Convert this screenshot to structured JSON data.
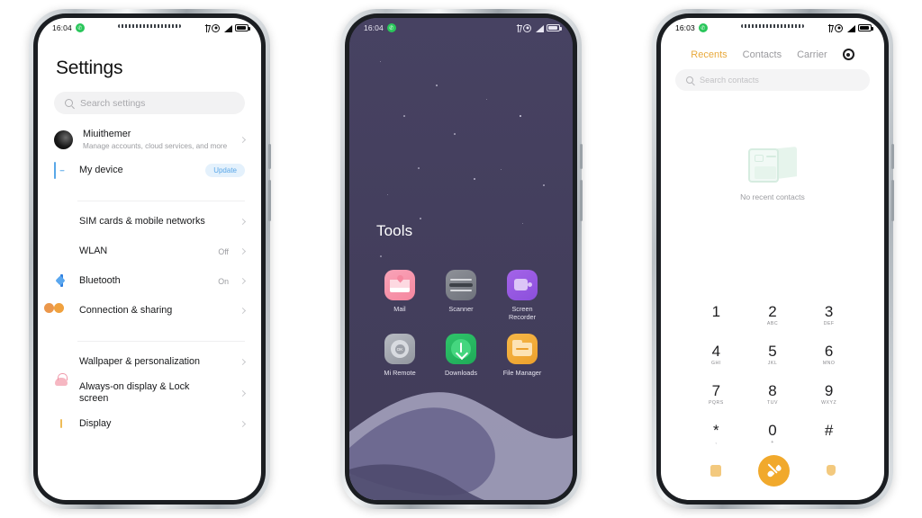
{
  "page": {
    "background": "#ffffff",
    "device_count": 3
  },
  "phone1": {
    "status": {
      "time": "16:04",
      "call_icon": "phone-badge-icon",
      "icons": [
        "bluetooth-icon",
        "alarm-icon",
        "signal-icon",
        "battery-icon"
      ]
    },
    "title": "Settings",
    "search": {
      "placeholder": "Search settings",
      "icon": "search-icon"
    },
    "account": {
      "name": "Miuithemer",
      "subtitle": "Manage accounts, cloud services, and more",
      "avatar": "user-avatar"
    },
    "rows": [
      {
        "label": "My device",
        "badge": "Update",
        "icon": "device-icon",
        "value": ""
      },
      {
        "label": "SIM cards & mobile networks",
        "icon": "sim-card-icon",
        "value": ""
      },
      {
        "label": "WLAN",
        "icon": "wifi-icon",
        "value": "Off"
      },
      {
        "label": "Bluetooth",
        "icon": "bluetooth-icon",
        "value": "On"
      },
      {
        "label": "Connection & sharing",
        "icon": "connection-icon",
        "value": ""
      },
      {
        "label": "Wallpaper & personalization",
        "icon": "wallpaper-icon",
        "value": ""
      },
      {
        "label": "Always-on display & Lock screen",
        "icon": "lock-screen-icon",
        "value": ""
      },
      {
        "label": "Display",
        "icon": "display-icon",
        "value": ""
      }
    ],
    "colors": {
      "badge_text": "#5aa7e8",
      "badge_bg": "#e4f1fc",
      "title": "#111111"
    }
  },
  "phone2": {
    "status": {
      "time": "16:04",
      "call_icon": "phone-badge-icon",
      "icons": [
        "bluetooth-icon",
        "alarm-icon",
        "signal-icon",
        "battery-icon"
      ]
    },
    "folder_title": "Tools",
    "wallpaper_colors": {
      "base": "#443f5f",
      "wave_light": "#9b9ab8",
      "wave_mid": "#6d6a8e"
    },
    "apps": [
      {
        "label": "Mail",
        "icon": "mail-app-icon",
        "color": "#f5879f"
      },
      {
        "label": "Scanner",
        "icon": "scanner-app-icon",
        "color": "#6f737c"
      },
      {
        "label": "Screen Recorder",
        "icon": "screen-recorder-app-icon",
        "color": "#8b4fdc"
      },
      {
        "label": "Mi Remote",
        "icon": "mi-remote-app-icon",
        "color": "#92969e"
      },
      {
        "label": "Downloads",
        "icon": "downloads-app-icon",
        "color": "#1faa58"
      },
      {
        "label": "File Manager",
        "icon": "file-manager-app-icon",
        "color": "#eda12c"
      }
    ]
  },
  "phone3": {
    "status": {
      "time": "16:03",
      "call_icon": "phone-badge-icon",
      "icons": [
        "bluetooth-icon",
        "alarm-icon",
        "signal-icon",
        "battery-icon"
      ]
    },
    "tabs": [
      {
        "label": "Recents",
        "active": true
      },
      {
        "label": "Contacts",
        "active": false
      },
      {
        "label": "Carrier",
        "active": false
      }
    ],
    "settings_icon": "gear-icon",
    "search": {
      "placeholder": "Search contacts",
      "icon": "search-icon"
    },
    "empty_state": {
      "text": "No recent contacts",
      "icon": "contact-card-icon"
    },
    "keypad": [
      {
        "num": "1",
        "sub": ""
      },
      {
        "num": "2",
        "sub": "ABC"
      },
      {
        "num": "3",
        "sub": "DEF"
      },
      {
        "num": "4",
        "sub": "GHI"
      },
      {
        "num": "5",
        "sub": "JKL"
      },
      {
        "num": "6",
        "sub": "MNO"
      },
      {
        "num": "7",
        "sub": "PQRS"
      },
      {
        "num": "8",
        "sub": "TUV"
      },
      {
        "num": "9",
        "sub": "WXYZ"
      },
      {
        "num": "*",
        "sub": ","
      },
      {
        "num": "0",
        "sub": "+"
      },
      {
        "num": "#",
        "sub": ""
      }
    ],
    "actions": [
      {
        "icon": "keypad-toggle-icon"
      },
      {
        "icon": "call-button-icon"
      },
      {
        "icon": "more-options-icon"
      }
    ],
    "colors": {
      "accent": "#e8a93c",
      "call_button": "#f1a92c"
    }
  }
}
